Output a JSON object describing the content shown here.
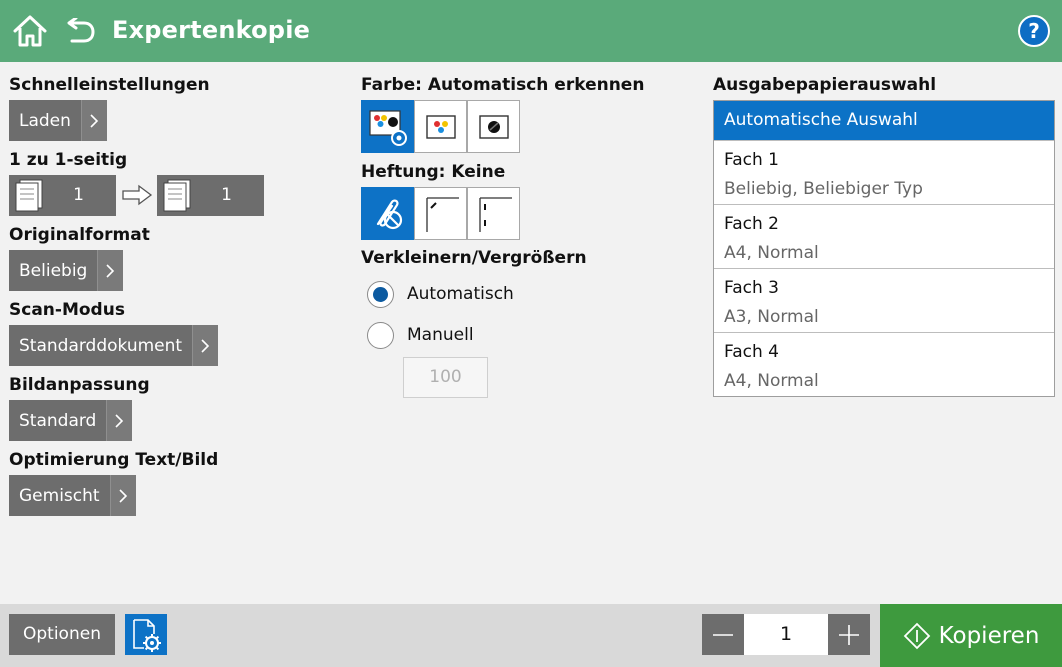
{
  "header": {
    "title": "Expertenkopie",
    "home_icon": "home-icon",
    "back_icon": "back-arrow-icon",
    "help_label": "?"
  },
  "left": {
    "quick_settings": {
      "label": "Schnelleinstellungen",
      "button": "Laden"
    },
    "sides": {
      "label": "1 zu 1-seitig",
      "input_count": "1",
      "output_count": "1"
    },
    "original_format": {
      "label": "Originalformat",
      "value": "Beliebig"
    },
    "scan_mode": {
      "label": "Scan-Modus",
      "value": "Standarddokument"
    },
    "image_adjust": {
      "label": "Bildanpassung",
      "value": "Standard"
    },
    "optimize": {
      "label": "Optimierung Text/Bild",
      "value": "Gemischt"
    }
  },
  "middle": {
    "color": {
      "label": "Farbe: Automatisch erkennen",
      "options": [
        "color-auto-icon",
        "color-icon",
        "black-white-icon"
      ],
      "selected": 0
    },
    "staple": {
      "label": "Heftung: Keine",
      "options": [
        "no-staple-icon",
        "staple-corner-icon",
        "staple-side-icon"
      ],
      "selected": 0
    },
    "resize": {
      "label": "Verkleinern/Vergrößern",
      "auto_label": "Automatisch",
      "manual_label": "Manuell",
      "selected": "Automatisch",
      "percent_value": "100"
    }
  },
  "right": {
    "paper": {
      "label": "Ausgabepapierauswahl",
      "auto": "Automatische Auswahl",
      "trays": [
        {
          "name": "Fach 1",
          "desc": "Beliebig, Beliebiger Typ"
        },
        {
          "name": "Fach 2",
          "desc": "A4, Normal"
        },
        {
          "name": "Fach 3",
          "desc": "A3, Normal"
        },
        {
          "name": "Fach 4",
          "desc": "A4, Normal"
        }
      ]
    }
  },
  "footer": {
    "options": "Optionen",
    "copies": "1",
    "copy_button": "Kopieren"
  },
  "colors": {
    "header": "#5aaa7a",
    "accent": "#0d72c6",
    "button_gray": "#6d6d6d",
    "copy_green": "#3e9a3e"
  }
}
